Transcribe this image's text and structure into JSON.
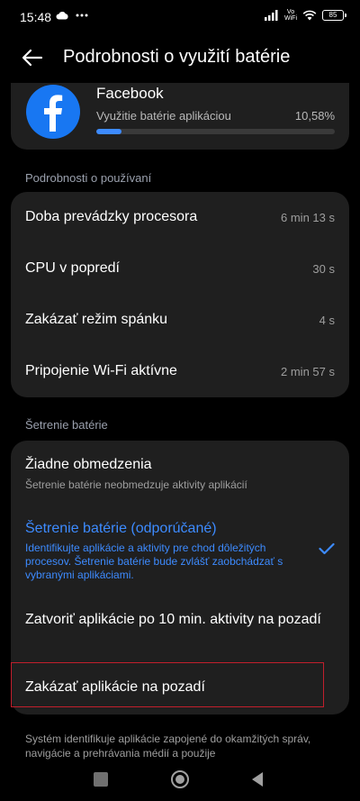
{
  "status": {
    "time": "15:48",
    "icons": [
      "cloud-icon",
      "more-icon",
      "signal-icon",
      "volte-wifi-icon",
      "wifi-icon",
      "battery-icon"
    ],
    "volte_top": "Vo",
    "volte_bottom": "WiFi",
    "battery": "85"
  },
  "header": {
    "title": "Podrobnosti o využití batérie"
  },
  "app": {
    "name": "Facebook",
    "usage_label": "Využitie batérie aplikáciou",
    "usage_percent": "10,58%",
    "usage_fraction": 0.1058
  },
  "details": {
    "header": "Podrobnosti o používaní",
    "rows": [
      {
        "label": "Doba prevádzky procesora",
        "value": "6 min 13 s"
      },
      {
        "label": "CPU v popredí",
        "value": "30 s"
      },
      {
        "label": "Zakázať režim spánku",
        "value": "4 s"
      },
      {
        "label": "Pripojenie Wi-Fi aktívne",
        "value": "2 min 57 s"
      }
    ]
  },
  "saver": {
    "header": "Šetrenie batérie",
    "options": [
      {
        "title": "Žiadne obmedzenia",
        "subtitle": "Šetrenie batérie neobmedzuje aktivity aplikácií"
      },
      {
        "title": "Šetrenie batérie (odporúčané)",
        "subtitle": "Identifikujte aplikácie a aktivity pre chod dôležitých procesov. Šetrenie batérie bude zvlášť zaobchádzať s vybranými aplikáciami.",
        "selected": true
      },
      {
        "title": "Zatvoriť aplikácie po 10 min. aktivity na pozadí"
      },
      {
        "title": "Zakázať aplikácie na pozadí"
      }
    ],
    "accent_color": "#3d8bff",
    "highlight_color": "#c11f2c"
  },
  "footer": {
    "note": "Systém identifikuje aplikácie zapojené do okamžitých správ, navigácie a prehrávania médií a použije"
  },
  "nav": {
    "icons": [
      "recents-icon",
      "home-icon",
      "back-nav-icon"
    ]
  }
}
